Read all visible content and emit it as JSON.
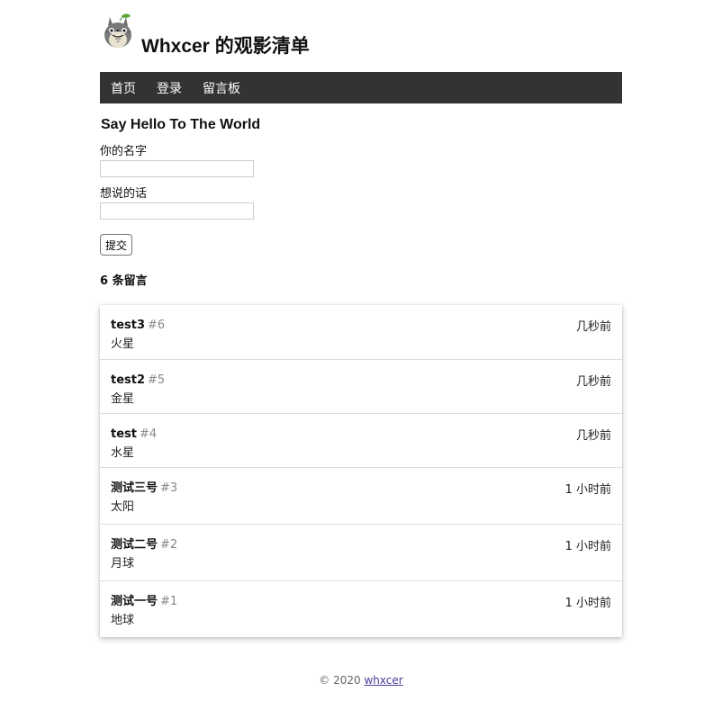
{
  "site": {
    "title": "Whxcer 的观影清单"
  },
  "nav": {
    "items": [
      {
        "label": "首页"
      },
      {
        "label": "登录"
      },
      {
        "label": "留言板"
      }
    ]
  },
  "form": {
    "title": "Say Hello To The World",
    "name_label": "你的名字",
    "name_value": "",
    "message_label": "想说的话",
    "message_value": "",
    "submit_label": "提交"
  },
  "messages": {
    "count_text": "6 条留言",
    "items": [
      {
        "name": "test3",
        "id": "#6",
        "text": "火星",
        "time": "几秒前"
      },
      {
        "name": "test2",
        "id": "#5",
        "text": "金星",
        "time": "几秒前"
      },
      {
        "name": "test",
        "id": "#4",
        "text": "水星",
        "time": "几秒前"
      },
      {
        "name": "测试三号",
        "id": "#3",
        "text": "太阳",
        "time": "1 小时前"
      },
      {
        "name": "测试二号",
        "id": "#2",
        "text": "月球",
        "time": "1 小时前"
      },
      {
        "name": "测试一号",
        "id": "#1",
        "text": "地球",
        "time": "1 小时前"
      }
    ]
  },
  "footer": {
    "copyright": "© 2020",
    "link_text": "whxcer"
  },
  "icons": {
    "avatar": "totoro-avatar-icon"
  },
  "colors": {
    "nav_bg": "#333333",
    "footer_link": "#4a3b9a"
  }
}
